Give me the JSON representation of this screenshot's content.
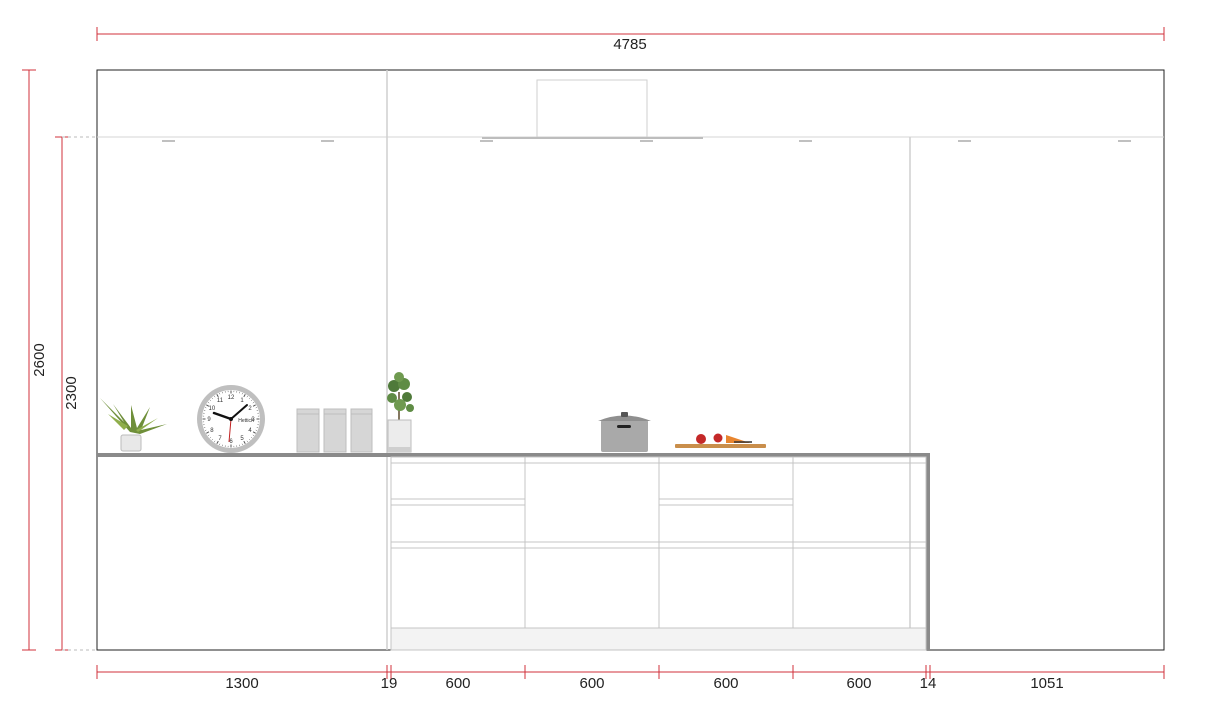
{
  "colors": {
    "dimension_line": "#d0303b",
    "outline": "#222222",
    "guide": "#cccccc",
    "cabinet_line": "#bdbdbd",
    "worktop": "#8a8a8a"
  },
  "dimensions": {
    "overall_width": "4785",
    "total_height": "2600",
    "ceiling_height": "2300",
    "bottom_segments": [
      {
        "value": "1300"
      },
      {
        "value": "19"
      },
      {
        "value": "600"
      },
      {
        "value": "600"
      },
      {
        "value": "600"
      },
      {
        "value": "600"
      },
      {
        "value": "14"
      },
      {
        "value": "1051"
      }
    ]
  },
  "clock": {
    "brand": "Hettich",
    "numerals": [
      "12",
      "1",
      "2",
      "3",
      "4",
      "5",
      "6",
      "7",
      "8",
      "9",
      "10",
      "11"
    ]
  },
  "objects": [
    "plant-icon",
    "clock-icon",
    "canister-icon",
    "potted-tree-icon",
    "pot-icon",
    "cutting-board-icon"
  ]
}
